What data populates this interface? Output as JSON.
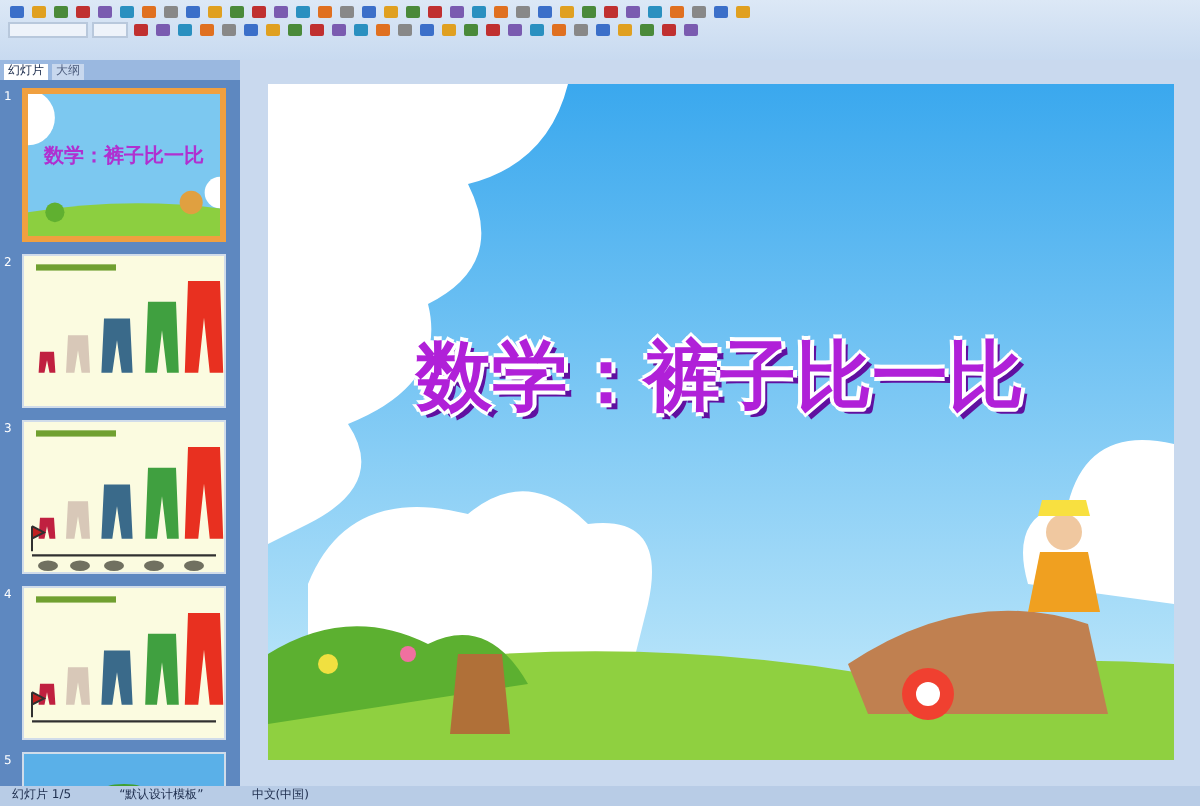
{
  "pane_tabs": [
    {
      "label": "幻灯片",
      "selected": true
    },
    {
      "label": "大纲",
      "selected": false
    }
  ],
  "slides": [
    {
      "number": "1",
      "selected": true,
      "kind": "title",
      "title": "数学：裤子比一比"
    },
    {
      "number": "2",
      "selected": false,
      "kind": "pants"
    },
    {
      "number": "3",
      "selected": false,
      "kind": "pants_line_stones"
    },
    {
      "number": "4",
      "selected": false,
      "kind": "pants_line"
    },
    {
      "number": "5",
      "selected": false,
      "kind": "sky"
    }
  ],
  "slide": {
    "title": "数学：裤子比一比"
  },
  "status_bar": [
    "幻灯片 1/5",
    "“默认设计模板”",
    "中文(中国)"
  ]
}
